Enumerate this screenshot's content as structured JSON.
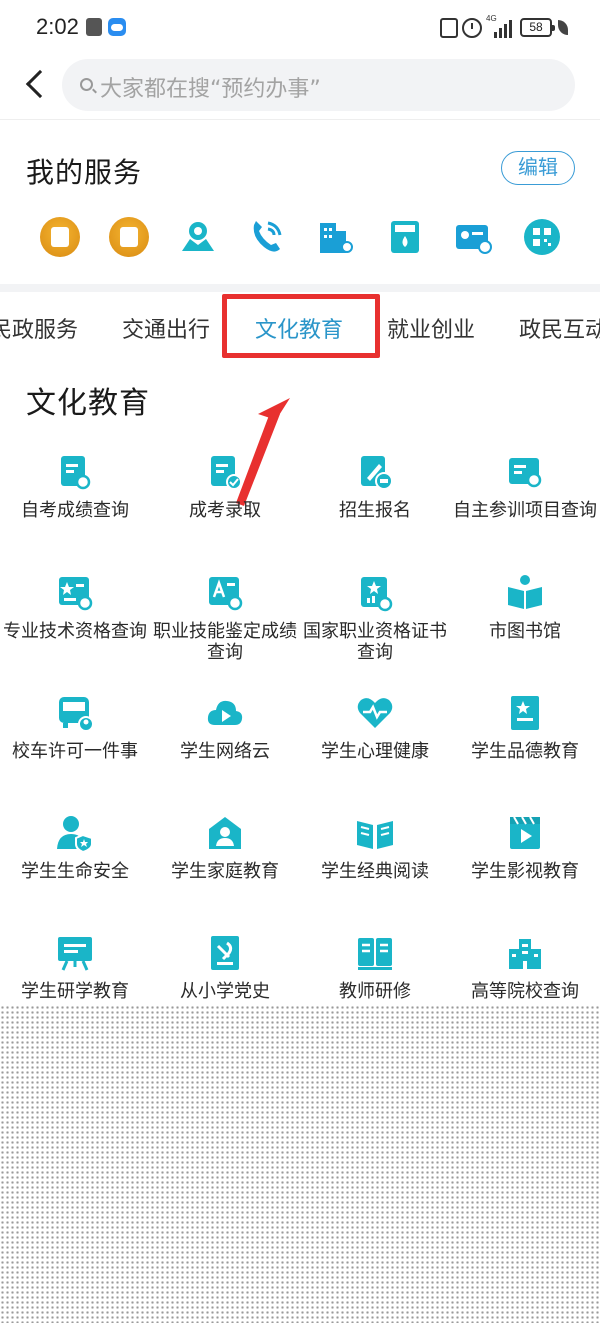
{
  "status_bar": {
    "time": "2:02",
    "battery": "58",
    "network": "4G"
  },
  "header": {
    "search_placeholder": "大家都在搜“预约办事”"
  },
  "my_services": {
    "title": "我的服务",
    "edit_label": "编辑",
    "icons": [
      "calendar-icon",
      "house-yuan-icon",
      "map-pin-icon",
      "phone-icon",
      "building-search-icon",
      "water-meter-icon",
      "id-card-search-icon",
      "qr-code-icon"
    ]
  },
  "tabs": {
    "items": [
      "民政服务",
      "交通出行",
      "文化教育",
      "就业创业",
      "政民互动"
    ],
    "active": "文化教育"
  },
  "culture": {
    "title": "文化教育",
    "items": [
      {
        "label": "自考成绩查询",
        "icon": "document-search-icon"
      },
      {
        "label": "成考录取",
        "icon": "document-check-icon"
      },
      {
        "label": "招生报名",
        "icon": "enroll-pen-icon"
      },
      {
        "label": "自主参训项目查询",
        "icon": "training-search-icon"
      },
      {
        "label": "专业技术资格查询",
        "icon": "certificate-search-icon"
      },
      {
        "label": "职业技能鉴定成绩查询",
        "icon": "skill-score-icon"
      },
      {
        "label": "国家职业资格证书查询",
        "icon": "badge-doc-icon"
      },
      {
        "label": "市图书馆",
        "icon": "book-open-icon"
      },
      {
        "label": "校车许可一件事",
        "icon": "school-bus-icon"
      },
      {
        "label": "学生网络云",
        "icon": "cloud-play-icon"
      },
      {
        "label": "学生心理健康",
        "icon": "heart-pulse-icon"
      },
      {
        "label": "学生品德教育",
        "icon": "book-star-icon"
      },
      {
        "label": "学生生命安全",
        "icon": "person-shield-icon"
      },
      {
        "label": "学生家庭教育",
        "icon": "home-person-icon"
      },
      {
        "label": "学生经典阅读",
        "icon": "book-read-icon"
      },
      {
        "label": "学生影视教育",
        "icon": "film-play-icon"
      },
      {
        "label": "学生研学教育",
        "icon": "easel-icon"
      },
      {
        "label": "从小学党史",
        "icon": "party-book-icon"
      },
      {
        "label": "教师研修",
        "icon": "books-icon"
      },
      {
        "label": "高等院校查询",
        "icon": "university-building-icon"
      }
    ]
  },
  "colors": {
    "accent": "#2a95c9",
    "icon_teal": "#1ab5c8",
    "highlight_red": "#e8302f"
  }
}
